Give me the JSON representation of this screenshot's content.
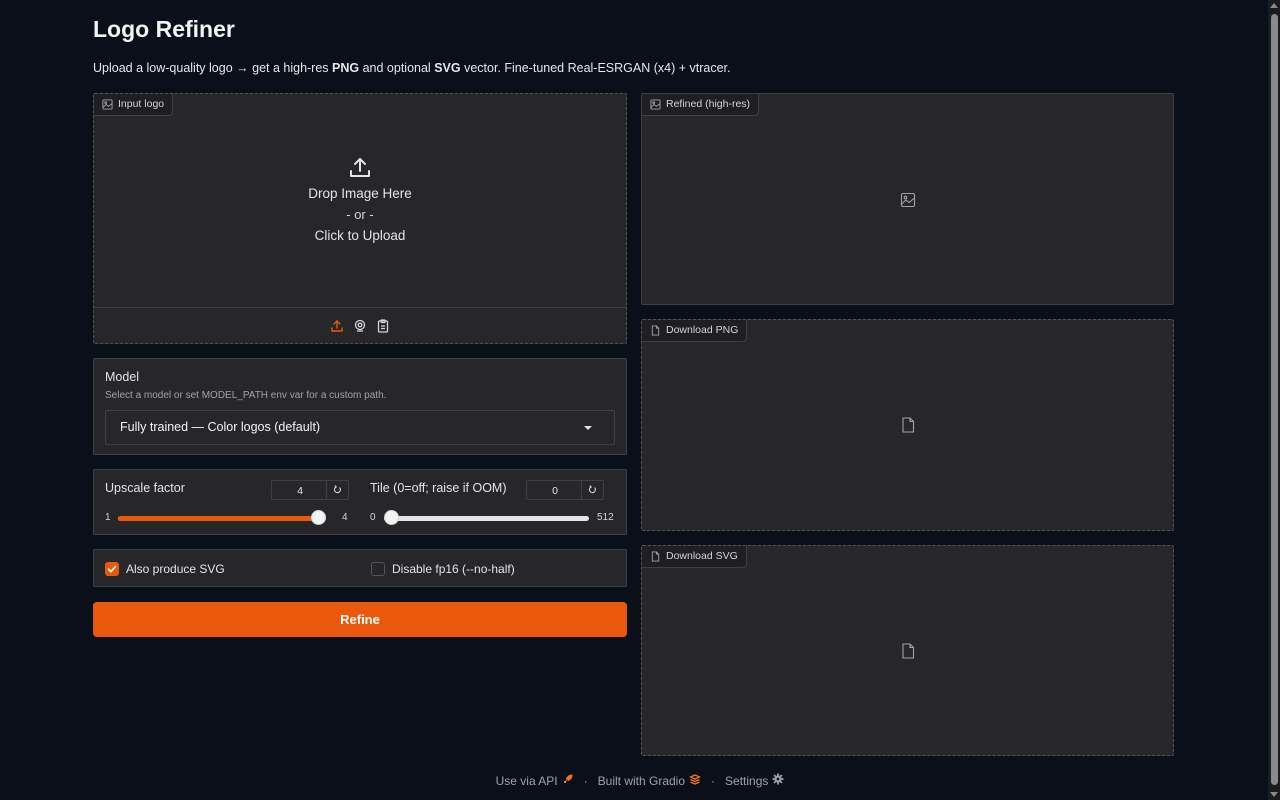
{
  "app": {
    "title": "Logo Refiner",
    "description": {
      "p1": "Upload a low-quality logo → get a high-res ",
      "b1": "PNG",
      "p2": " and optional ",
      "b2": "SVG",
      "p3": " vector. Fine-tuned Real-ESRGAN (x4) + vtracer."
    }
  },
  "input_logo": {
    "label": "Input logo",
    "icon": "image-icon",
    "drop_text": "Drop Image Here",
    "or_text": "- or -",
    "click_text": "Click to Upload",
    "sources": [
      "upload-icon",
      "webcam-icon",
      "clipboard-icon"
    ]
  },
  "model": {
    "label": "Model",
    "info": "Select a model or set MODEL_PATH env var for a custom path.",
    "selected": "Fully trained — Color logos (default)"
  },
  "upscale": {
    "label": "Upscale factor",
    "value": "4",
    "min": "1",
    "max": "4",
    "fraction": 1.0
  },
  "tile": {
    "label": "Tile (0=off; raise if OOM)",
    "value": "0",
    "min": "0",
    "max": "512",
    "fraction": 0.0
  },
  "options": {
    "also_svg": {
      "label": "Also produce SVG",
      "checked": true
    },
    "disable_fp16": {
      "label": "Disable fp16 (--no-half)",
      "checked": false
    }
  },
  "refine_button": {
    "label": "Refine"
  },
  "outputs": {
    "refined": {
      "label": "Refined (high-res)",
      "icon": "image-icon"
    },
    "download_png": {
      "label": "Download PNG",
      "icon": "file-icon"
    },
    "download_svg": {
      "label": "Download SVG",
      "icon": "file-icon"
    }
  },
  "footer": {
    "api": "Use via API",
    "built": "Built with Gradio",
    "settings": "Settings",
    "separator": "·"
  },
  "colors": {
    "accent": "#ea580c",
    "background": "#0b0f19",
    "panel": "#27272a"
  }
}
